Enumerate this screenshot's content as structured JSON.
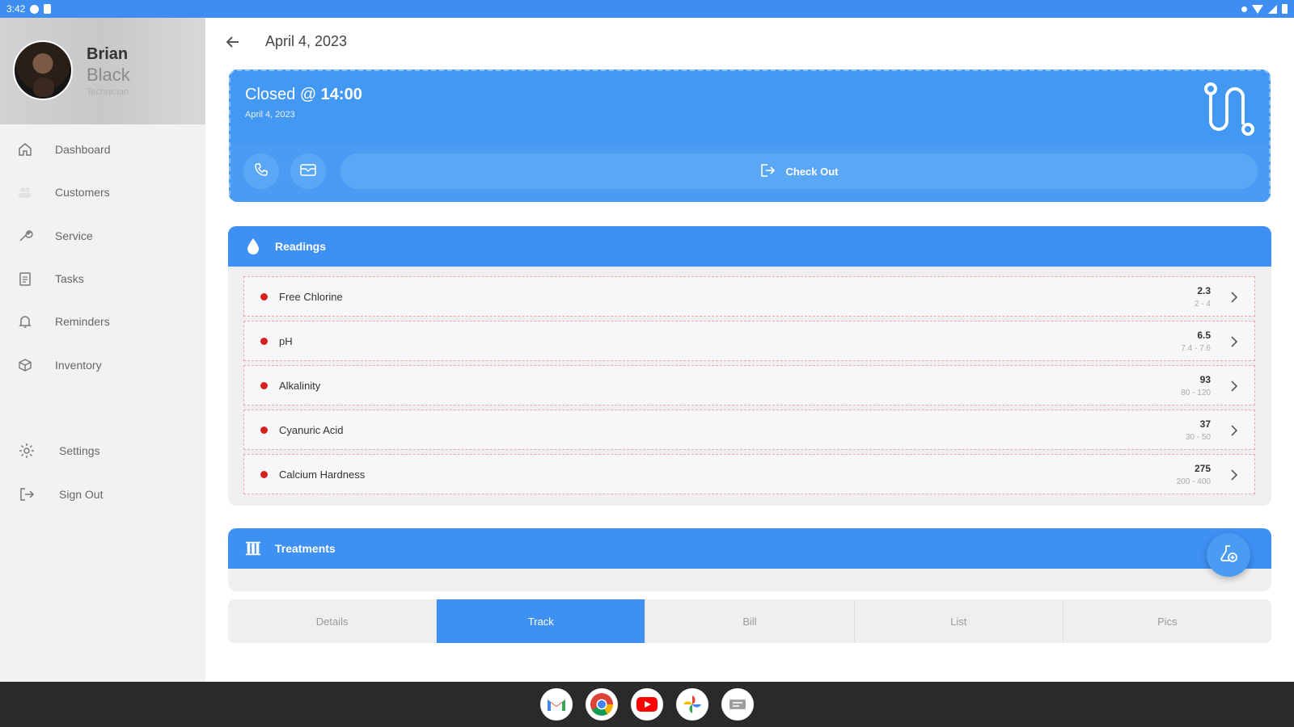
{
  "status_bar": {
    "time": "3:42"
  },
  "profile": {
    "first_name": "Brian",
    "last_name": "Black",
    "role": "Technician"
  },
  "nav": {
    "items": [
      {
        "label": "Dashboard",
        "icon": "home-icon"
      },
      {
        "label": "Customers",
        "icon": "people-icon"
      },
      {
        "label": "Service",
        "icon": "wrench-icon"
      },
      {
        "label": "Tasks",
        "icon": "clipboard-icon"
      },
      {
        "label": "Reminders",
        "icon": "bell-icon"
      },
      {
        "label": "Inventory",
        "icon": "box-icon"
      }
    ],
    "bottom": [
      {
        "label": "Settings",
        "icon": "gear-icon"
      },
      {
        "label": "Sign Out",
        "icon": "sign-out-icon"
      }
    ]
  },
  "header": {
    "title": "April 4, 2023"
  },
  "visit": {
    "closed_prefix": "Closed @ ",
    "closed_time": "14:00",
    "date": "April 4, 2023",
    "checkout_label": "Check Out"
  },
  "readings": {
    "title": "Readings",
    "rows": [
      {
        "label": "Free Chlorine",
        "value": "2.3",
        "range": "2 - 4"
      },
      {
        "label": "pH",
        "value": "6.5",
        "range": "7.4 - 7.6"
      },
      {
        "label": "Alkalinity",
        "value": "93",
        "range": "80 - 120"
      },
      {
        "label": "Cyanuric Acid",
        "value": "37",
        "range": "30 - 50"
      },
      {
        "label": "Calcium Hardness",
        "value": "275",
        "range": "200 - 400"
      }
    ]
  },
  "treatments": {
    "title": "Treatments"
  },
  "tabs": [
    {
      "label": "Details",
      "active": false
    },
    {
      "label": "Track",
      "active": true
    },
    {
      "label": "Bill",
      "active": false
    },
    {
      "label": "List",
      "active": false
    },
    {
      "label": "Pics",
      "active": false
    }
  ],
  "colors": {
    "primary": "#3e90f2",
    "alert_dot": "#d62020",
    "sidebar_bg": "#f2f2f4"
  },
  "dock": [
    "gmail-icon",
    "chrome-icon",
    "youtube-icon",
    "photos-icon",
    "messages-icon"
  ]
}
